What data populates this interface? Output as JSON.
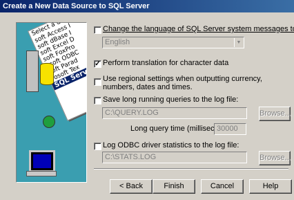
{
  "window": {
    "title": "Create a New Data Source to SQL Server"
  },
  "art": {
    "list_header": "Select a driver fo",
    "items": [
      "soft Access I",
      "soft dBase I",
      "soft Excel D",
      "soft FoxPro",
      "osoft ODBC",
      "soft Parad",
      "rosoft Tex",
      "SQL Serve"
    ]
  },
  "options": {
    "change_language": {
      "label": "Change the language of SQL Server system messages to:",
      "checked": false
    },
    "language_select": {
      "value": "English"
    },
    "perform_translation": {
      "label": "Perform translation for character data",
      "checked": true
    },
    "regional_settings": {
      "label": "Use regional settings when outputting currency, numbers, dates and times.",
      "checked": false
    },
    "save_long_queries": {
      "label": "Save long running queries to the log file:",
      "checked": false
    },
    "query_log_path": {
      "value": "C:\\QUERY.LOG"
    },
    "browse1": {
      "label": "Browse..."
    },
    "long_query_time": {
      "label": "Long query time (milliseconds):",
      "value": "30000"
    },
    "log_odbc_stats": {
      "label": "Log ODBC driver statistics to the log file:",
      "checked": false
    },
    "stats_log_path": {
      "value": "C:\\STATS.LOG"
    },
    "browse2": {
      "label": "Browse..."
    }
  },
  "buttons": {
    "back": "< Back",
    "finish": "Finish",
    "cancel": "Cancel",
    "help": "Help"
  }
}
